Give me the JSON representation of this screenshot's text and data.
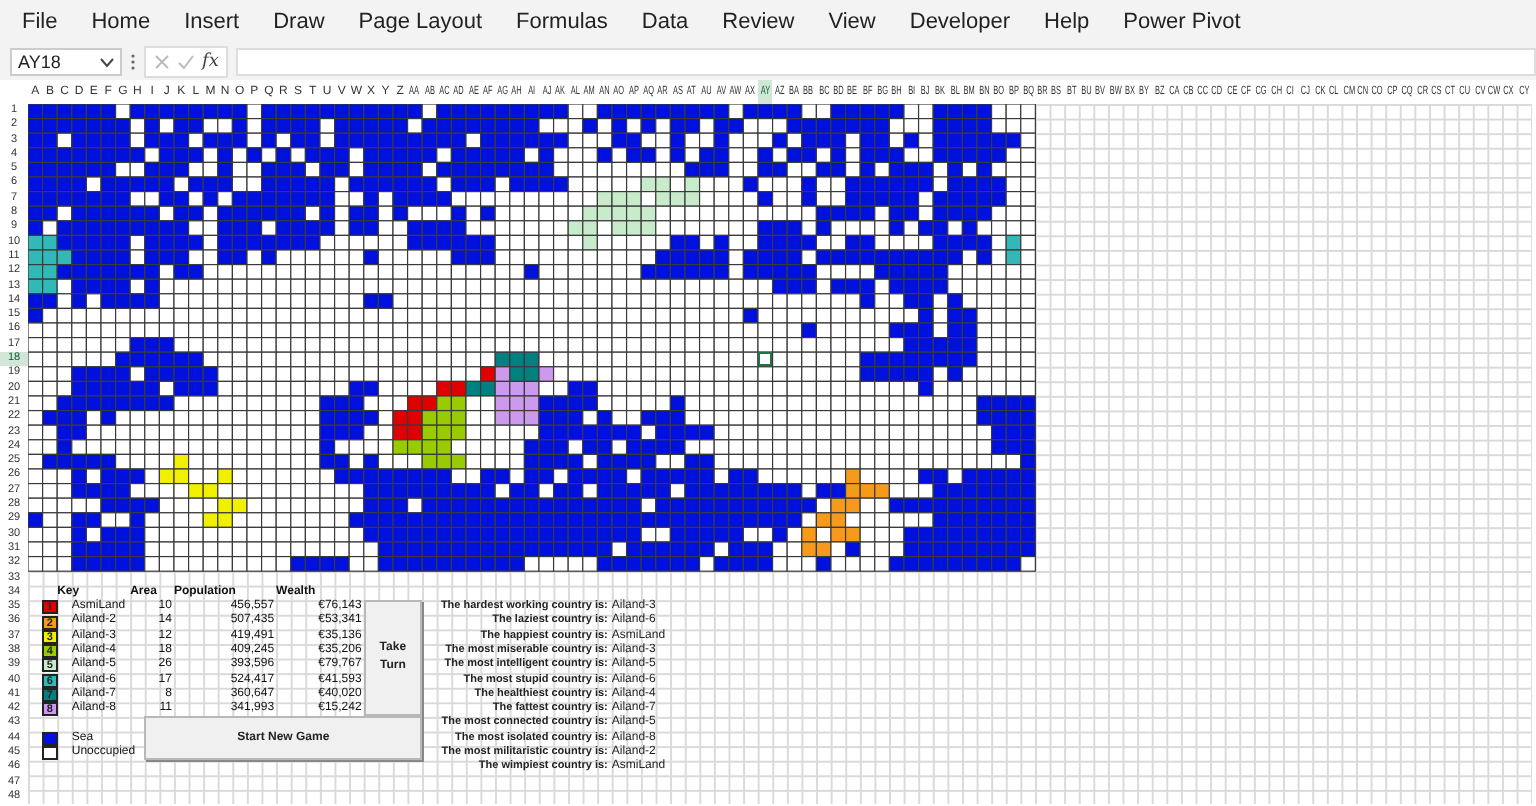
{
  "menu": [
    "File",
    "Home",
    "Insert",
    "Draw",
    "Page Layout",
    "Formulas",
    "Data",
    "Review",
    "View",
    "Developer",
    "Help",
    "Power Pivot"
  ],
  "formula_bar": {
    "name_box": "AY18",
    "fx": "fx"
  },
  "sheet": {
    "columns": [
      {
        "label": "A",
        "selected": false
      },
      {
        "label": "B",
        "selected": false
      },
      {
        "label": "C",
        "selected": false
      },
      {
        "label": "D",
        "selected": false
      },
      {
        "label": "E",
        "selected": false
      },
      {
        "label": "F",
        "selected": false
      },
      {
        "label": "G",
        "selected": false
      },
      {
        "label": "H",
        "selected": false
      },
      {
        "label": "I",
        "selected": false
      },
      {
        "label": "J",
        "selected": false
      },
      {
        "label": "K",
        "selected": false
      },
      {
        "label": "L",
        "selected": false
      },
      {
        "label": "M",
        "selected": false
      },
      {
        "label": "N",
        "selected": false
      },
      {
        "label": "O",
        "selected": false
      },
      {
        "label": "P",
        "selected": false
      },
      {
        "label": "Q",
        "selected": false
      },
      {
        "label": "R",
        "selected": false
      },
      {
        "label": "S",
        "selected": false
      },
      {
        "label": "T",
        "selected": false
      },
      {
        "label": "U",
        "selected": false
      },
      {
        "label": "V",
        "selected": false
      },
      {
        "label": "W",
        "selected": false
      },
      {
        "label": "X",
        "selected": false
      },
      {
        "label": "Y",
        "selected": false
      },
      {
        "label": "Z",
        "selected": false
      },
      {
        "label": "AA",
        "selected": false
      },
      {
        "label": "AB",
        "selected": false
      },
      {
        "label": "AC",
        "selected": false
      },
      {
        "label": "AD",
        "selected": false
      },
      {
        "label": "AE",
        "selected": false
      },
      {
        "label": "AF",
        "selected": false
      },
      {
        "label": "AG",
        "selected": false
      },
      {
        "label": "AH",
        "selected": false
      },
      {
        "label": "AI",
        "selected": false
      },
      {
        "label": "AJ",
        "selected": false
      },
      {
        "label": "AK",
        "selected": false
      },
      {
        "label": "AL",
        "selected": false
      },
      {
        "label": "AM",
        "selected": false
      },
      {
        "label": "AN",
        "selected": false
      },
      {
        "label": "AO",
        "selected": false
      },
      {
        "label": "AP",
        "selected": false
      },
      {
        "label": "AQ",
        "selected": false
      },
      {
        "label": "AR",
        "selected": false
      },
      {
        "label": "AS",
        "selected": false
      },
      {
        "label": "AT",
        "selected": false
      },
      {
        "label": "AU",
        "selected": false
      },
      {
        "label": "AV",
        "selected": false
      },
      {
        "label": "AW",
        "selected": false
      },
      {
        "label": "AX",
        "selected": false
      },
      {
        "label": "AY",
        "selected": true
      },
      {
        "label": "AZ",
        "selected": false
      },
      {
        "label": "BA",
        "selected": false
      },
      {
        "label": "BB",
        "selected": false
      },
      {
        "label": "BC",
        "selected": false
      },
      {
        "label": "BD",
        "selected": false
      },
      {
        "label": "BE",
        "selected": false
      },
      {
        "label": "BF",
        "selected": false
      },
      {
        "label": "BG",
        "selected": false
      },
      {
        "label": "BH",
        "selected": false
      },
      {
        "label": "BI",
        "selected": false
      },
      {
        "label": "BJ",
        "selected": false
      },
      {
        "label": "BK",
        "selected": false
      },
      {
        "label": "BL",
        "selected": false
      },
      {
        "label": "BM",
        "selected": false
      },
      {
        "label": "BN",
        "selected": false
      },
      {
        "label": "BO",
        "selected": false
      },
      {
        "label": "BP",
        "selected": false
      },
      {
        "label": "BQ",
        "selected": false
      },
      {
        "label": "BR",
        "selected": false
      },
      {
        "label": "BS",
        "selected": false
      },
      {
        "label": "BT",
        "selected": false
      },
      {
        "label": "BU",
        "selected": false
      },
      {
        "label": "BV",
        "selected": false
      },
      {
        "label": "BW",
        "selected": false
      },
      {
        "label": "BX",
        "selected": false
      },
      {
        "label": "BY",
        "selected": false
      },
      {
        "label": "BZ",
        "selected": false
      },
      {
        "label": "CA",
        "selected": false
      },
      {
        "label": "CB",
        "selected": false
      },
      {
        "label": "CC",
        "selected": false
      },
      {
        "label": "CD",
        "selected": false
      },
      {
        "label": "CE",
        "selected": false
      },
      {
        "label": "CF",
        "selected": false
      },
      {
        "label": "CG",
        "selected": false
      },
      {
        "label": "CH",
        "selected": false
      },
      {
        "label": "CI",
        "selected": false
      },
      {
        "label": "CJ",
        "selected": false
      },
      {
        "label": "CK",
        "selected": false
      },
      {
        "label": "CL",
        "selected": false
      },
      {
        "label": "CM",
        "selected": false
      },
      {
        "label": "CN",
        "selected": false
      },
      {
        "label": "CO",
        "selected": false
      },
      {
        "label": "CP",
        "selected": false
      },
      {
        "label": "CQ",
        "selected": false
      },
      {
        "label": "CR",
        "selected": false
      },
      {
        "label": "CS",
        "selected": false
      },
      {
        "label": "CT",
        "selected": false
      },
      {
        "label": "CU",
        "selected": false
      },
      {
        "label": "CV",
        "selected": false
      },
      {
        "label": "CW",
        "selected": false
      },
      {
        "label": "CX",
        "selected": false
      },
      {
        "label": "CY",
        "selected": false
      }
    ],
    "rows": [
      {
        "label": "1",
        "selected": false
      },
      {
        "label": "2",
        "selected": false
      },
      {
        "label": "3",
        "selected": false
      },
      {
        "label": "4",
        "selected": false
      },
      {
        "label": "5",
        "selected": false
      },
      {
        "label": "6",
        "selected": false
      },
      {
        "label": "7",
        "selected": false
      },
      {
        "label": "8",
        "selected": false
      },
      {
        "label": "9",
        "selected": false
      },
      {
        "label": "10",
        "selected": false
      },
      {
        "label": "11",
        "selected": false
      },
      {
        "label": "12",
        "selected": false
      },
      {
        "label": "13",
        "selected": false
      },
      {
        "label": "14",
        "selected": false
      },
      {
        "label": "15",
        "selected": false
      },
      {
        "label": "16",
        "selected": false
      },
      {
        "label": "17",
        "selected": false
      },
      {
        "label": "18",
        "selected": true
      },
      {
        "label": "19",
        "selected": false
      },
      {
        "label": "20",
        "selected": false
      },
      {
        "label": "21",
        "selected": false
      },
      {
        "label": "22",
        "selected": false
      },
      {
        "label": "23",
        "selected": false
      },
      {
        "label": "24",
        "selected": false
      },
      {
        "label": "25",
        "selected": false
      },
      {
        "label": "26",
        "selected": false
      },
      {
        "label": "27",
        "selected": false
      },
      {
        "label": "28",
        "selected": false
      },
      {
        "label": "29",
        "selected": false
      },
      {
        "label": "30",
        "selected": false
      },
      {
        "label": "31",
        "selected": false
      },
      {
        "label": "32",
        "selected": false
      },
      {
        "label": "33",
        "selected": false
      },
      {
        "label": "34",
        "selected": false
      },
      {
        "label": "35",
        "selected": false
      },
      {
        "label": "36",
        "selected": false
      },
      {
        "label": "37",
        "selected": false
      },
      {
        "label": "38",
        "selected": false
      },
      {
        "label": "39",
        "selected": false
      },
      {
        "label": "40",
        "selected": false
      },
      {
        "label": "41",
        "selected": false
      },
      {
        "label": "42",
        "selected": false
      },
      {
        "label": "43",
        "selected": false
      },
      {
        "label": "44",
        "selected": false
      },
      {
        "label": "45",
        "selected": false
      },
      {
        "label": "46",
        "selected": false
      },
      {
        "label": "47",
        "selected": false
      },
      {
        "label": "48",
        "selected": false
      }
    ]
  },
  "key": {
    "title": "Key",
    "headers": [
      "Area",
      "Population",
      "Wealth"
    ]
  },
  "countries": [
    {
      "number": "1",
      "name": "AsmiLand",
      "area": "10",
      "population": "456,557",
      "wealth": "€76,143",
      "color": "#e00000"
    },
    {
      "number": "2",
      "name": "Ailand-2",
      "area": "14",
      "population": "507,435",
      "wealth": "€53,341",
      "color": "#f59a1a"
    },
    {
      "number": "3",
      "name": "Ailand-3",
      "area": "12",
      "population": "419,491",
      "wealth": "€35,136",
      "color": "#f0f000"
    },
    {
      "number": "4",
      "name": "Ailand-4",
      "area": "18",
      "population": "409,245",
      "wealth": "€35,206",
      "color": "#99cc00"
    },
    {
      "number": "5",
      "name": "Ailand-5",
      "area": "26",
      "population": "393,596",
      "wealth": "€79,767",
      "color": "#c8eccb"
    },
    {
      "number": "6",
      "name": "Ailand-6",
      "area": "17",
      "population": "524,417",
      "wealth": "€41,593",
      "color": "#33b8b8"
    },
    {
      "number": "7",
      "name": "Ailand-7",
      "area": "8",
      "population": "360,647",
      "wealth": "€40,020",
      "color": "#008080"
    },
    {
      "number": "8",
      "name": "Ailand-8",
      "area": "11",
      "population": "341,993",
      "wealth": "€15,242",
      "color": "#cc99ee"
    }
  ],
  "legend": [
    {
      "kind": "sea",
      "label": "Sea",
      "color": "#0010dd"
    },
    {
      "kind": "unoccupied",
      "label": "Unoccupied",
      "color": "#ffffff"
    }
  ],
  "buttons": {
    "take_turn": "Take Turn",
    "new_game": "Start New Game"
  },
  "stats": [
    {
      "label": "The hardest working country is:",
      "value": "Ailand-3"
    },
    {
      "label": "The laziest country is:",
      "value": "Ailand-6"
    },
    {
      "label": "The happiest country is:",
      "value": "AsmiLand"
    },
    {
      "label": "The most miserable country is:",
      "value": "Ailand-3"
    },
    {
      "label": "The most intelligent country is:",
      "value": "Ailand-5"
    },
    {
      "label": "The most stupid country is:",
      "value": "Ailand-6"
    },
    {
      "label": "The healthiest country is:",
      "value": "Ailand-4"
    },
    {
      "label": "The fattest country is:",
      "value": "Ailand-7"
    },
    {
      "label": "The most connected country is:",
      "value": "Ailand-5"
    },
    {
      "label": "The most isolated country is:",
      "value": "Ailand-8"
    },
    {
      "label": "The most militaristic country is:",
      "value": "Ailand-2"
    },
    {
      "label": "The wimpiest country is:",
      "value": "AsmiLand"
    }
  ]
}
